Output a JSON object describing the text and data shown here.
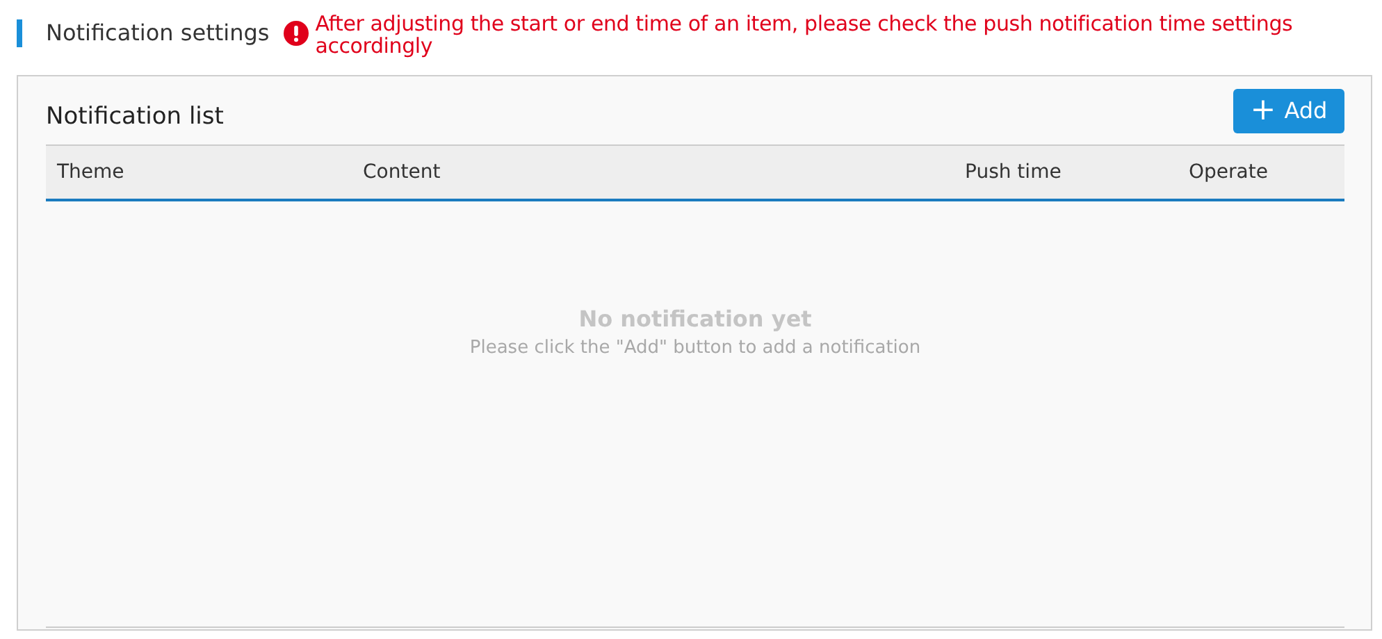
{
  "header": {
    "title": "Notification settings",
    "warning": "After adjusting the start or end time of an item, please check the push notification time settings accordingly"
  },
  "panel": {
    "title": "Notification list",
    "add_button": {
      "icon": "+",
      "label": "Add"
    }
  },
  "table": {
    "columns": [
      "Theme",
      "Content",
      "Push time",
      "Operate"
    ],
    "empty": {
      "title": "No notification yet",
      "hint": "Please click the \"Add\" button to add a notification"
    }
  }
}
